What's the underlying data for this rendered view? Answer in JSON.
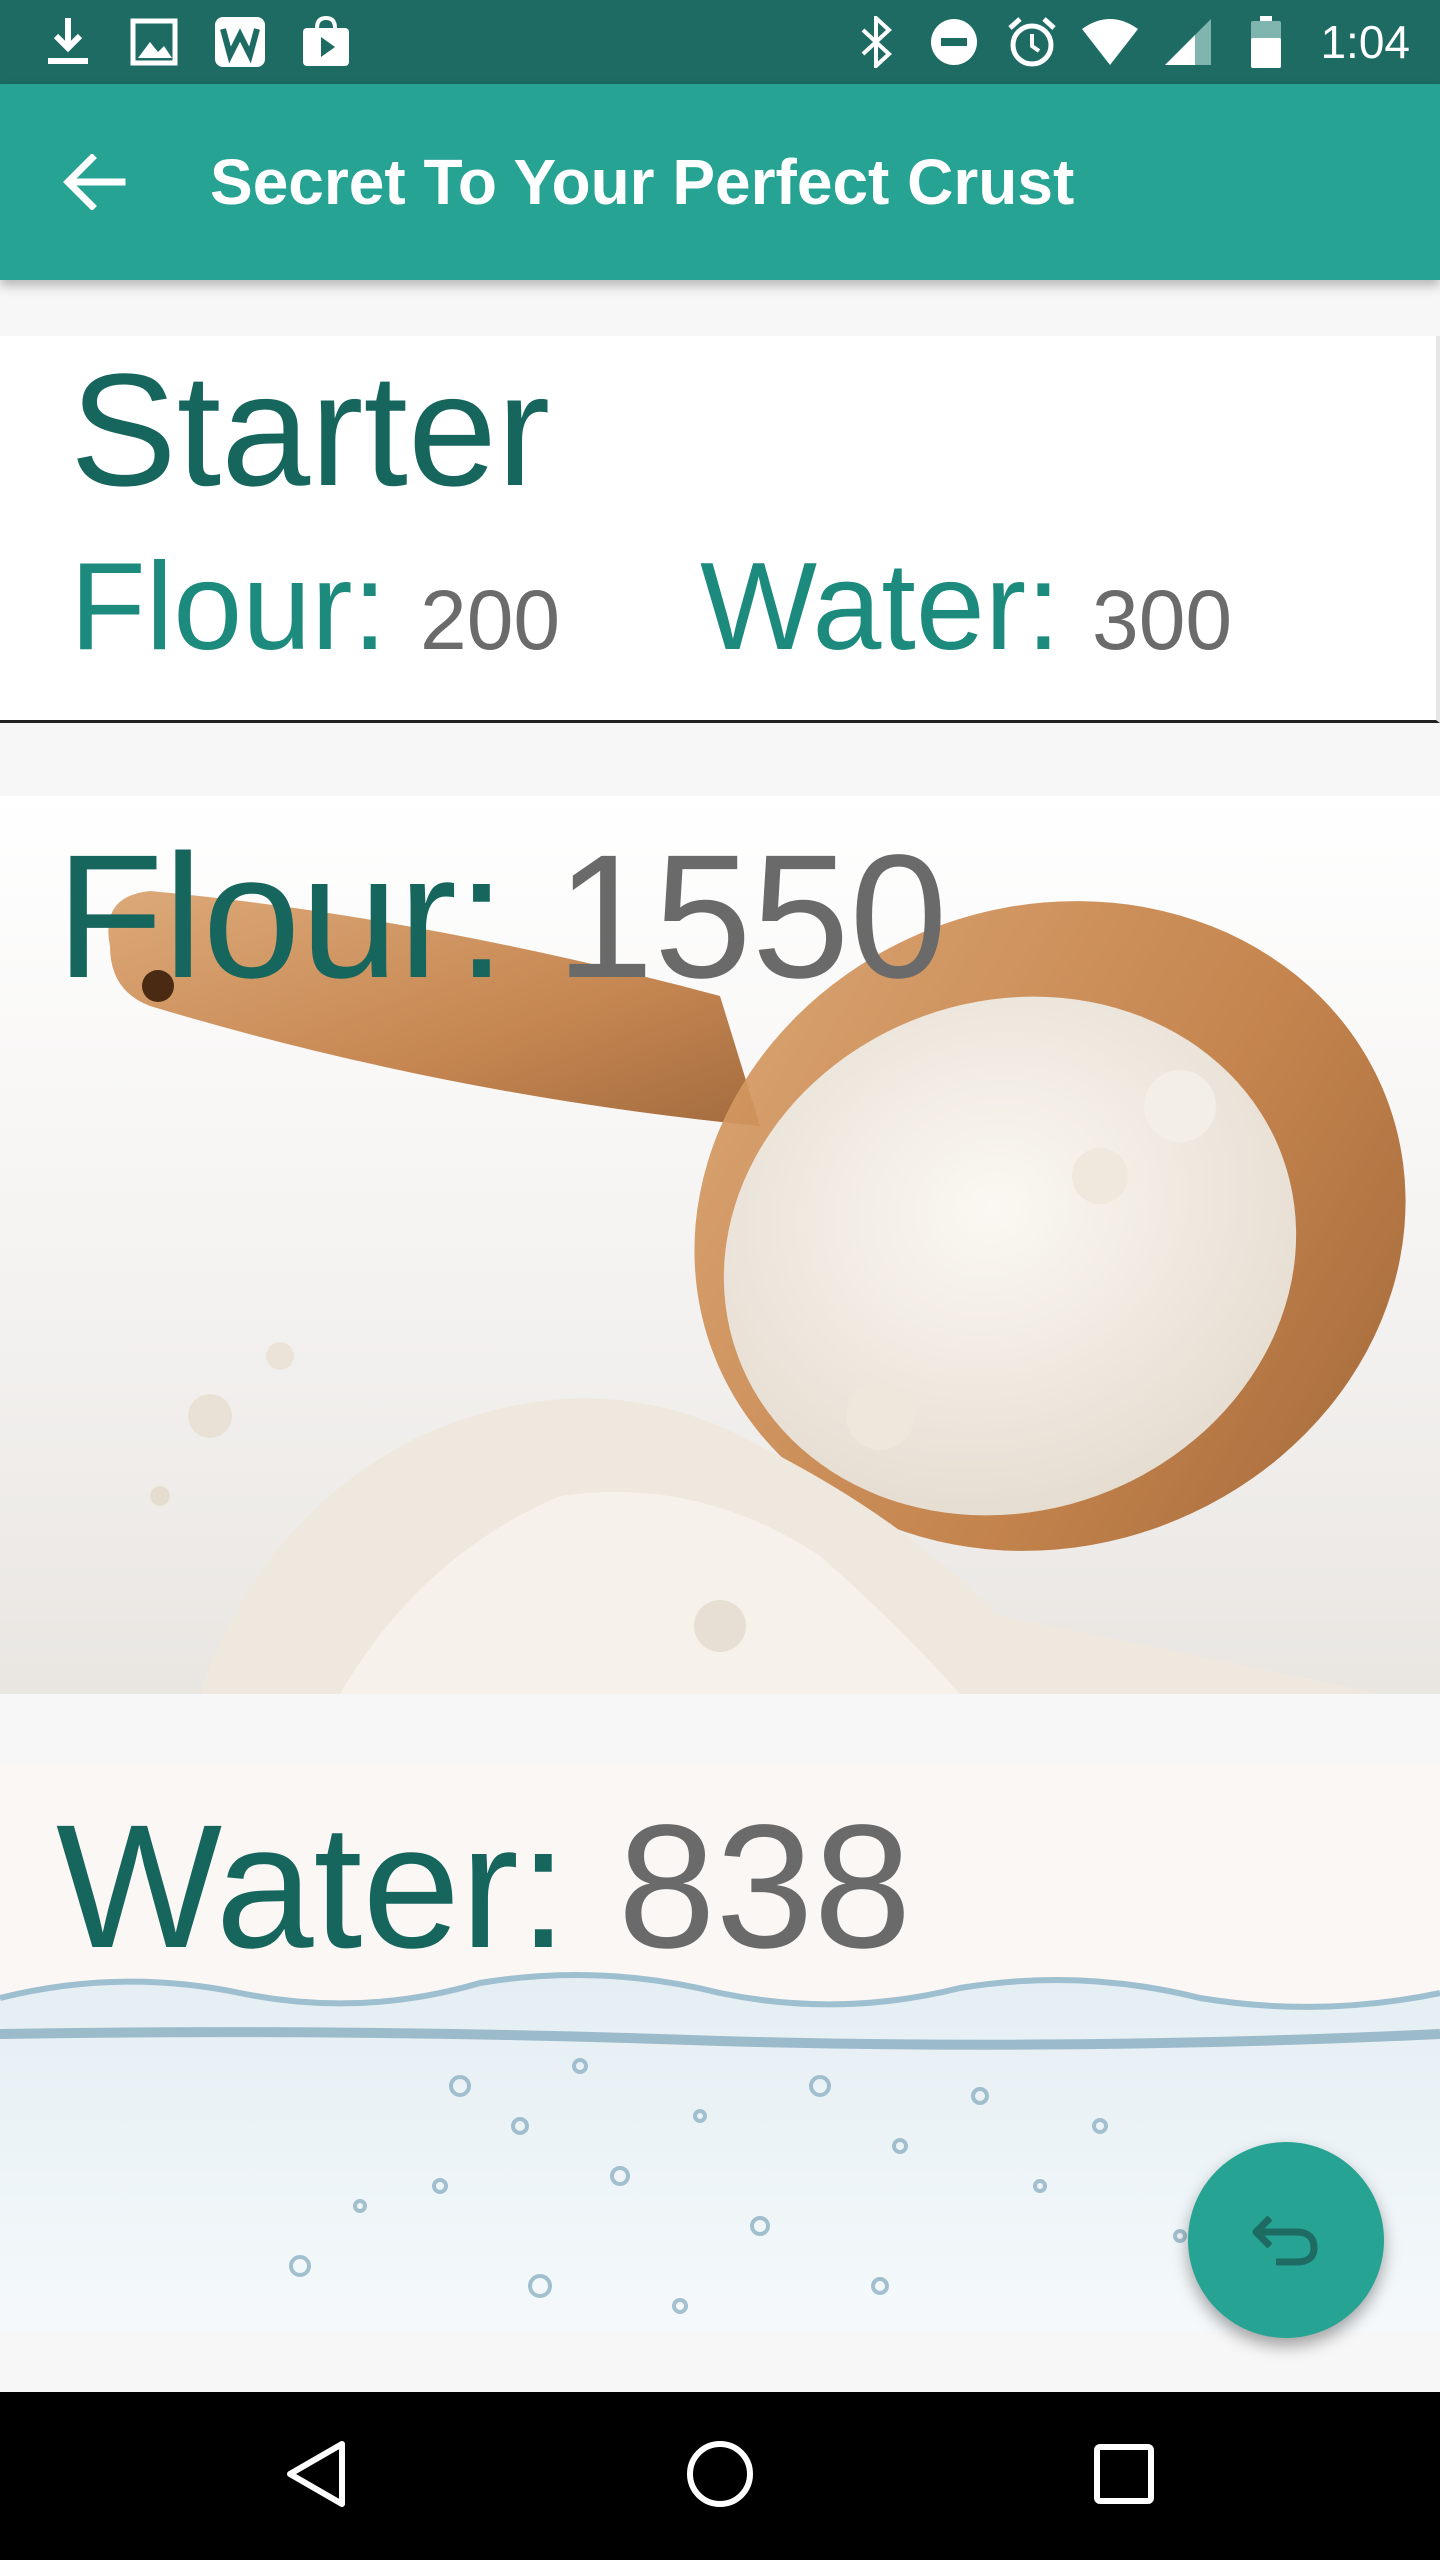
{
  "status_bar": {
    "time": "1:04",
    "left_icons": [
      "download-icon",
      "image-icon",
      "word-app-icon",
      "play-store-icon"
    ],
    "right_icons": [
      "bluetooth-icon",
      "do-not-disturb-icon",
      "alarm-icon",
      "wifi-icon",
      "signal-icon",
      "battery-icon"
    ]
  },
  "app_bar": {
    "title": "Secret To Your Perfect Crust",
    "back_icon": "arrow-back-icon",
    "color": "#27a394"
  },
  "starter": {
    "title": "Starter",
    "flour_label": "Flour:",
    "flour_value": "200",
    "water_label": "Water:",
    "water_value": "300"
  },
  "flour": {
    "label": "Flour:",
    "value": "1550"
  },
  "water": {
    "label": "Water:",
    "value": "838"
  },
  "fab": {
    "icon": "undo-icon"
  },
  "nav_bar": {
    "icons": [
      "nav-back-icon",
      "nav-home-icon",
      "nav-recents-icon"
    ]
  },
  "colors": {
    "accent": "#27a394",
    "status_bar": "#1d6b63",
    "label_dark": "#17665e",
    "label_teal": "#1d8a7e",
    "value_gray": "#6b6b6b"
  }
}
